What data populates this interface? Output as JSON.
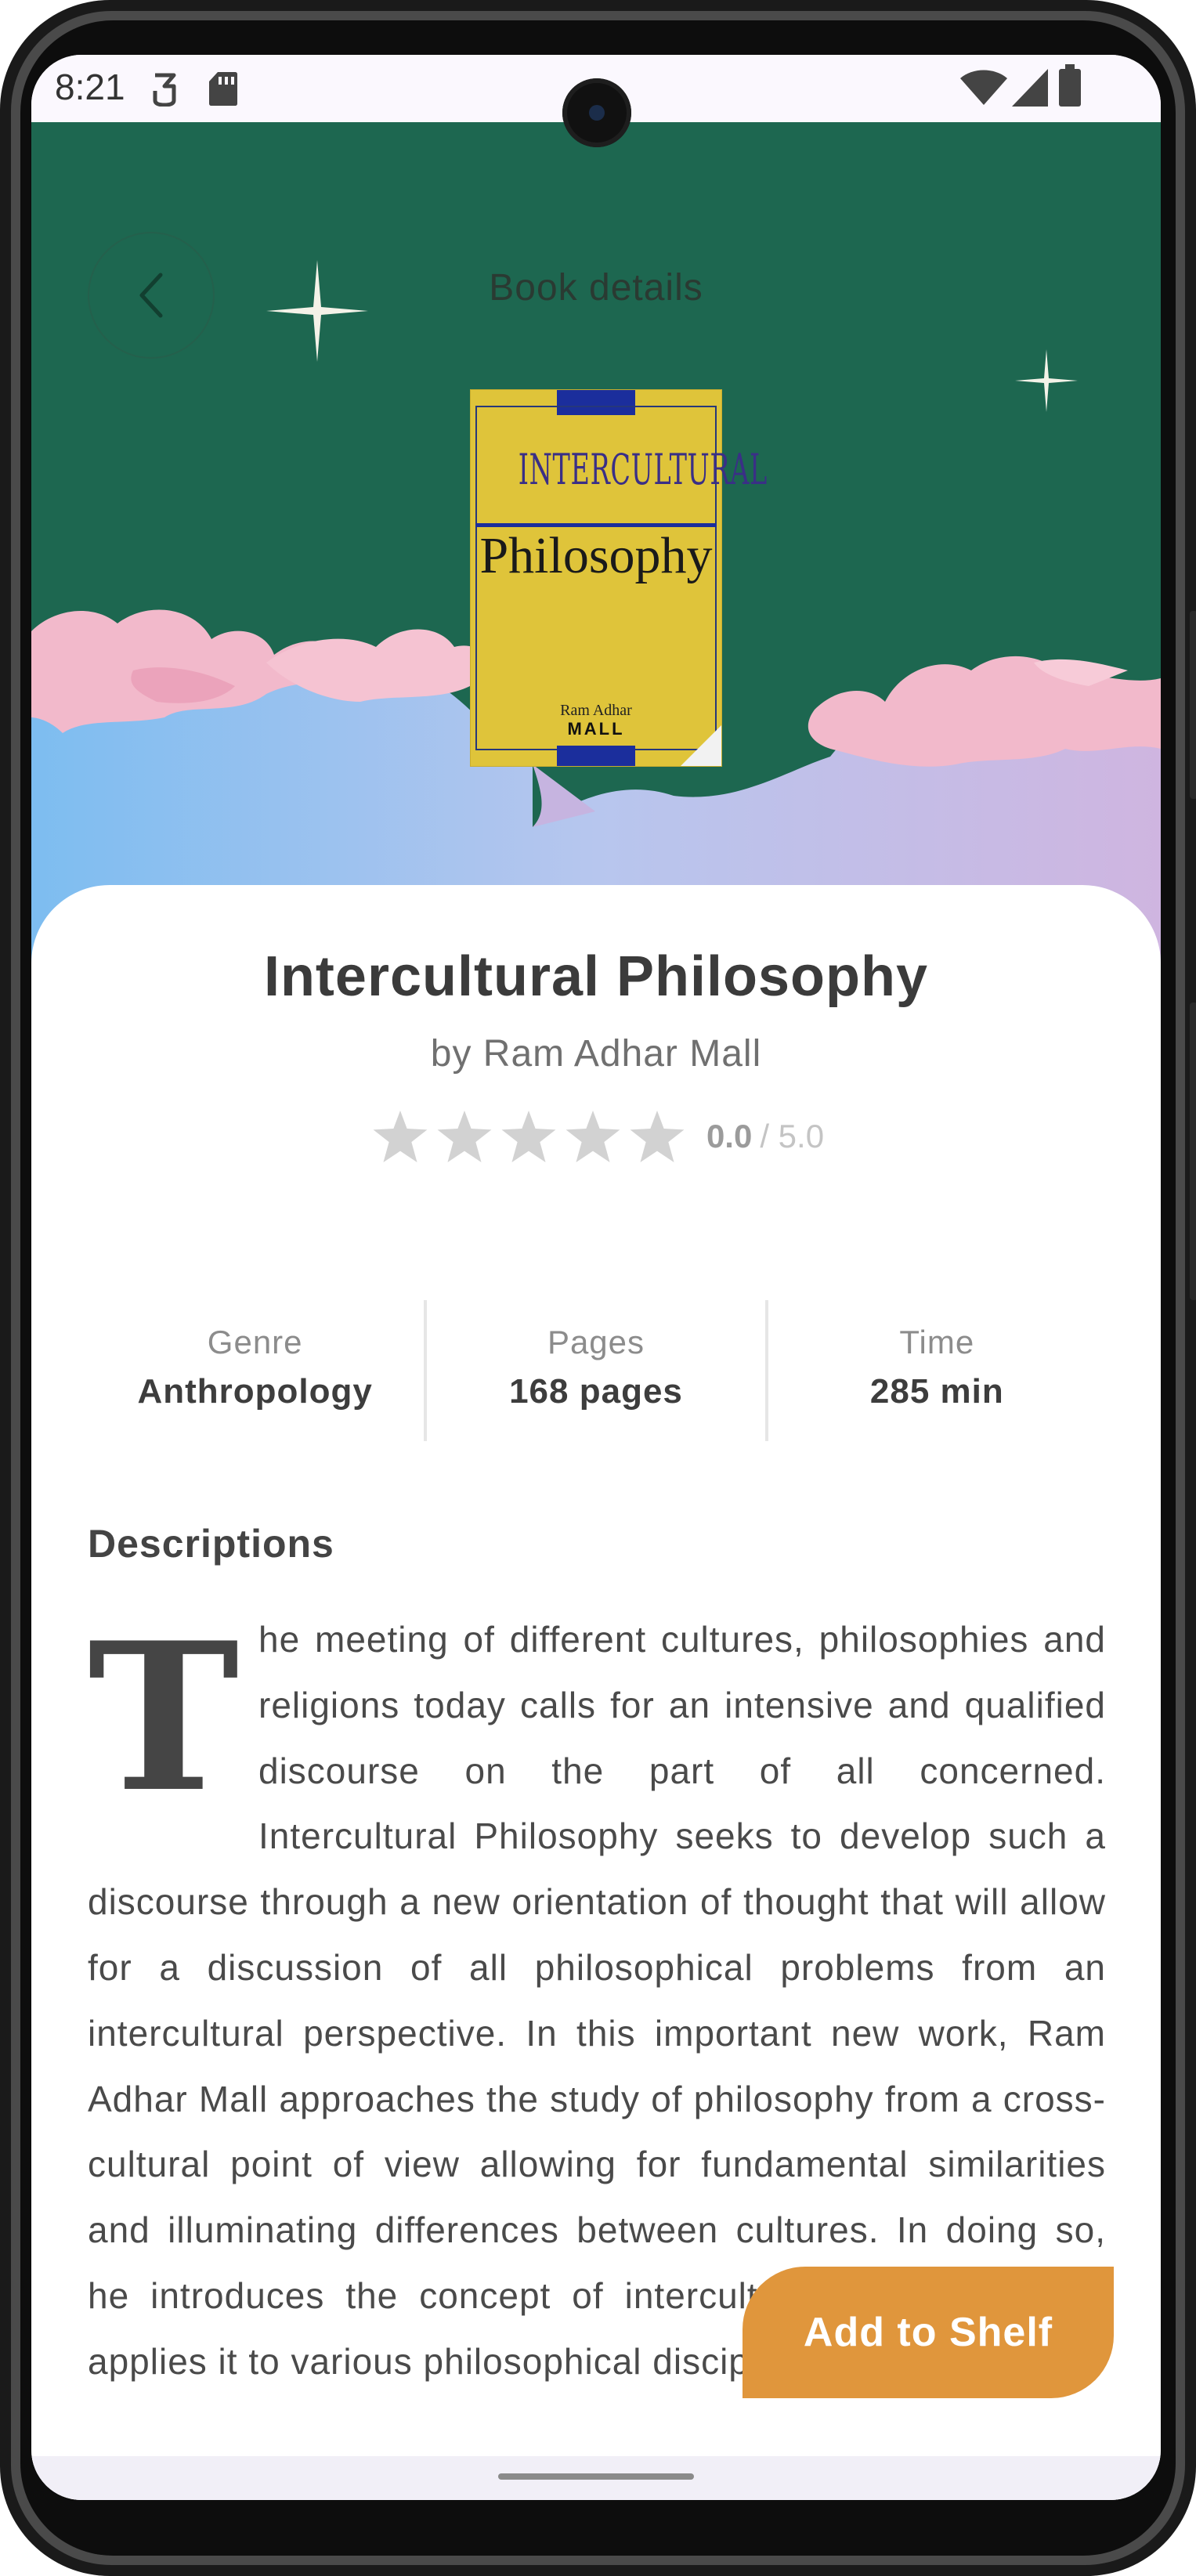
{
  "status_bar": {
    "time": "8:21",
    "left_icons": [
      "vpn-key-icon",
      "sd-card-icon"
    ],
    "right_icons": [
      "wifi-icon",
      "signal-icon",
      "battery-icon"
    ]
  },
  "header": {
    "title": "Book details",
    "back_icon": "chevron-left-icon",
    "background_color": "#1d6750"
  },
  "cover": {
    "title_line1": "INTERCULTURAL",
    "title_line2": "Philosophy",
    "author_line1": "Ram Adhar",
    "author_line2": "MALL",
    "background_color": "#dfc43a"
  },
  "book": {
    "title": "Intercultural Philosophy",
    "author": "by Ram Adhar Mall",
    "rating": "0.0",
    "rating_max": "/ 5.0",
    "rating_stars_filled": 0,
    "rating_stars_total": 5
  },
  "stats": [
    {
      "label": "Genre",
      "value": "Anthropology"
    },
    {
      "label": "Pages",
      "value": "168 pages"
    },
    {
      "label": "Time",
      "value": "285 min"
    }
  ],
  "description": {
    "heading": "Descriptions",
    "drop_cap": "T",
    "text": "he meeting of different cultures, philosophies and religions today calls for an intensive and qualified discourse on the part of all concerned. Intercultural Philosophy seeks to develop such a discourse through a new orientation of thought that will allow for a discussion of all philosophical problems from an intercultural perspective. In this important new work, Ram Adhar Mall approaches the study of philosophy from a cross-cultural point of view allowing for fundamental similarities and illuminating differences between cultures. In doing so, he introduces the concept of intercultural philosophy and applies it to various philosophical disciplines."
  },
  "actions": {
    "add_to_shelf": "Add to Shelf",
    "accent_color": "#e0963c"
  }
}
